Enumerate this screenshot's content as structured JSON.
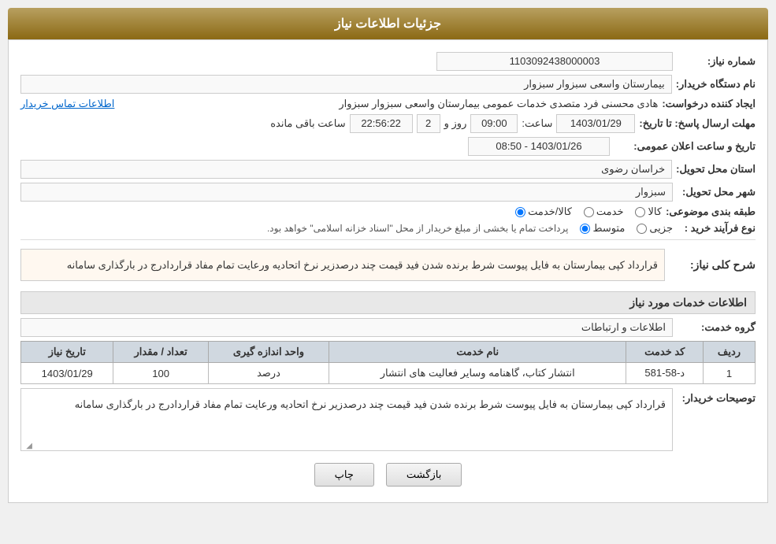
{
  "header": {
    "title": "جزئیات اطلاعات نیاز"
  },
  "fields": {
    "shomara_niaz_label": "شماره نیاز:",
    "shomara_niaz_value": "1103092438000003",
    "name_dastgah_label": "نام دستگاه خریدار:",
    "name_dastgah_value": "بیمارستان واسعی سبزوار سبزوار",
    "ijad_konande_label": "ایجاد کننده درخواست:",
    "ijad_konande_value": "هادی محسنی فرد متصدی خدمات عمومی بیمارستان واسعی سبزوار سبزوار",
    "contact_link": "اطلاعات تماس خریدار",
    "mohlat_ersal_label": "مهلت ارسال پاسخ: تا تاریخ:",
    "date_value": "1403/01/29",
    "time_label": "ساعت:",
    "time_value": "09:00",
    "rooz_label": "روز و",
    "rooz_value": "2",
    "saat_mande_label": "ساعت باقی مانده",
    "countdown_value": "22:56:22",
    "ostan_label": "استان محل تحویل:",
    "ostan_value": "خراسان رضوی",
    "shahr_label": "شهر محل تحویل:",
    "shahr_value": "سبزوار",
    "tabaqe_label": "طبقه بندی موضوعی:",
    "radio_kala": "کالا",
    "radio_khadamat": "خدمت",
    "radio_kala_khadamat": "کالا/خدمت",
    "nooe_farayand_label": "نوع فرآیند خرید :",
    "radio_jozee": "جزیی",
    "radio_mottasat": "متوسط",
    "radio_note": "پرداخت تمام یا بخشی از مبلغ خریدار از محل \"اسناد خزانه اسلامی\" خواهد بود.",
    "tarikh_elaan_label": "تاریخ و ساعت اعلان عمومی:",
    "tarikh_elaan_value": "1403/01/26 - 08:50",
    "sharh_section_title": "شرح کلی نیاز:",
    "sharh_text": "قرارداد کپی بیمارستان  به فایل پیوست شرط برنده شدن فید قیمت چند درصدزیر نرخ اتحادیه ورعایت تمام مفاد قراردادرج در بارگذاری سامانه",
    "services_section_title": "اطلاعات خدمات مورد نیاز",
    "grohe_khadamat_label": "گروه خدمت:",
    "grohe_khadamat_value": "اطلاعات و ارتباطات",
    "table": {
      "headers": [
        "ردیف",
        "کد خدمت",
        "نام خدمت",
        "واحد اندازه گیری",
        "تعداد / مقدار",
        "تاریخ نیاز"
      ],
      "rows": [
        {
          "radif": "1",
          "kod_khadamat": "د-58-581",
          "nam_khadamat": "انتشار کتاب، گاهنامه وسایر فعالیت های انتشار",
          "vahed": "درصد",
          "tedad": "100",
          "tarikh": "1403/01/29"
        }
      ]
    },
    "buyer_desc_label": "توصیحات خریدار:",
    "buyer_desc_value": "قرارداد کپی بیمارستان  به فایل پیوست شرط برنده شدن فید قیمت چند درصدزیر نرخ اتحادیه ورعایت تمام مفاد قراردادرج در بارگذاری سامانه",
    "btn_print": "چاپ",
    "btn_back": "بازگشت"
  }
}
